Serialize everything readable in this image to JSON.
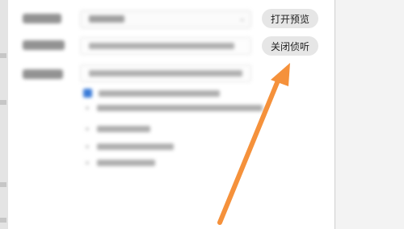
{
  "dialog": {
    "buttons": {
      "open_preview": "打开预览",
      "close_listen": "关闭侦听"
    }
  },
  "annotation": {
    "arrow_color": "#f5913b"
  }
}
